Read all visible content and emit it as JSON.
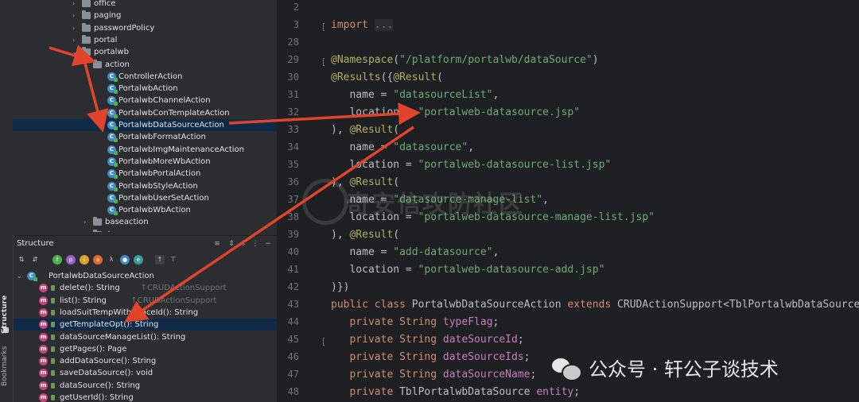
{
  "project_tree": {
    "items": [
      {
        "label": "office",
        "type": "folder",
        "depth": 0,
        "expanded": false
      },
      {
        "label": "paging",
        "type": "folder",
        "depth": 0,
        "expanded": false
      },
      {
        "label": "passwordPolicy",
        "type": "folder",
        "depth": 0,
        "expanded": false
      },
      {
        "label": "portal",
        "type": "folder",
        "depth": 0,
        "expanded": false
      },
      {
        "label": "portalwb",
        "type": "folder",
        "depth": 0,
        "expanded": true
      },
      {
        "label": "action",
        "type": "folder",
        "depth": 1,
        "expanded": true
      },
      {
        "label": "ControllerAction",
        "type": "class",
        "depth": 2
      },
      {
        "label": "PortalwbAction",
        "type": "class",
        "depth": 2
      },
      {
        "label": "PortalwbChannelAction",
        "type": "class",
        "depth": 2
      },
      {
        "label": "PortalwbConTemplateAction",
        "type": "class",
        "depth": 2
      },
      {
        "label": "PortalwbDataSourceAction",
        "type": "class",
        "depth": 2,
        "selected": true
      },
      {
        "label": "PortalwbFormatAction",
        "type": "class",
        "depth": 2
      },
      {
        "label": "PortalwbImgMaintenanceAction",
        "type": "class",
        "depth": 2
      },
      {
        "label": "PortalwbMoreWbAction",
        "type": "class",
        "depth": 2
      },
      {
        "label": "PortalwbPortalAction",
        "type": "class",
        "depth": 2
      },
      {
        "label": "PortalwbStyleAction",
        "type": "class",
        "depth": 2
      },
      {
        "label": "PortalwbUserSetAction",
        "type": "class",
        "depth": 2
      },
      {
        "label": "PortalwbWbAction",
        "type": "class",
        "depth": 2
      },
      {
        "label": "baseaction",
        "type": "folder",
        "depth": 1,
        "expanded": false
      },
      {
        "label": "dao",
        "type": "folder",
        "depth": 1,
        "expanded": false
      }
    ]
  },
  "structure": {
    "title": "Structure",
    "root": "PortalwbDataSourceAction",
    "members": [
      {
        "sig": "delete(): String",
        "inherited": "↑CRUDActionSupport"
      },
      {
        "sig": "list(): String",
        "inherited": "↑CRUDActionSupport"
      },
      {
        "sig": "loadSuitTempWithSpaceId(): String",
        "inherited": ""
      },
      {
        "sig": "getTemplateOpt(): String",
        "inherited": "",
        "selected": true
      },
      {
        "sig": "dataSourceManageList(): String",
        "inherited": ""
      },
      {
        "sig": "getPages(): Page",
        "inherited": ""
      },
      {
        "sig": "addDataSource(): String",
        "inherited": ""
      },
      {
        "sig": "saveDataSource(): void",
        "inherited": ""
      },
      {
        "sig": "dataSource(): String",
        "inherited": ""
      },
      {
        "sig": "getUserId(): String",
        "inherited": ""
      }
    ]
  },
  "side_tabs": {
    "structure": "Structure",
    "bookmarks": "Bookmarks"
  },
  "editor": {
    "line_numbers": [
      "2",
      "3",
      "28",
      "29",
      "30",
      "31",
      "32",
      "33",
      "34",
      "35",
      "36",
      "37",
      "38",
      "39",
      "40",
      "41",
      "42",
      "43",
      "44",
      "45",
      "46",
      "47",
      "48"
    ],
    "import_kw": "import",
    "import_fold": "...",
    "namespace_ann": "@Namespace",
    "namespace_val": "\"/platform/portalwb/dataSource\"",
    "results_ann": "@Results",
    "result_ann": "@Result",
    "name_kw": "name",
    "location_kw": "location",
    "r1_name": "\"datasourceList\"",
    "r1_loc": "\"portalweb-datasource.jsp\"",
    "r2_name": "\"datasource\"",
    "r2_loc": "\"portalweb-datasource-list.jsp\"",
    "r3_name": "\"datasource-manage-list\"",
    "r3_loc": "\"portalweb-datasource-manage-list.jsp\"",
    "r4_name": "\"add-datasource\"",
    "r4_loc": "\"portalweb-datasource-add.jsp\"",
    "class_decl_public": "public class",
    "class_name": "PortalwbDataSourceAction",
    "extends_kw": "extends",
    "super_class": "CRUDActionSupport<TblPortalwbDataSource",
    "private_kw": "private",
    "string_type": "String",
    "f1": "typeFlag",
    "f2": "dateSourceId",
    "f3": "dateSourceIds",
    "f4": "dataSourceName",
    "entity_type": "TblPortalwbDataSource",
    "f5": "entity"
  },
  "watermark": {
    "text": "奇安信攻防社区"
  },
  "footer": {
    "text": "公众号 · 轩公子谈技术"
  },
  "colors": {
    "arrow": "#e0452b",
    "selection": "#2e436e"
  }
}
